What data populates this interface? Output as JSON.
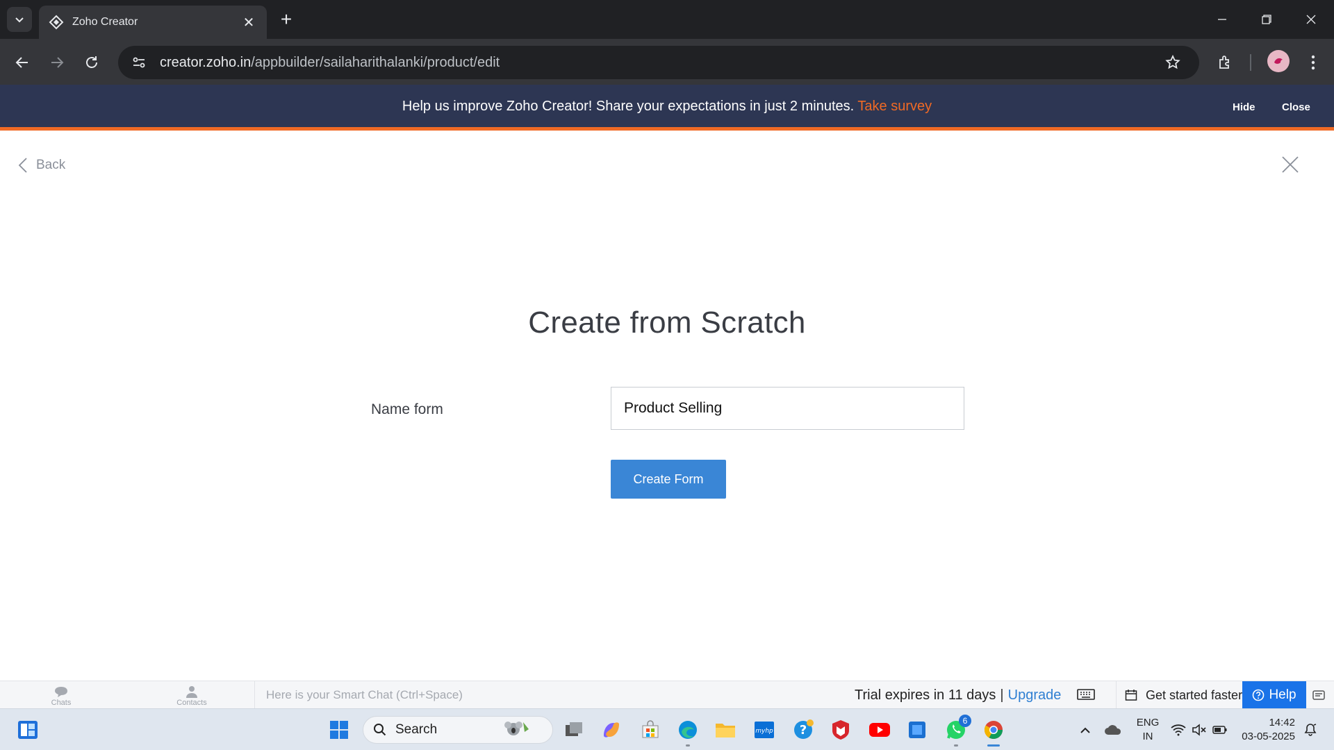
{
  "browser": {
    "tab_title": "Zoho Creator",
    "url_host": "creator.zoho.in",
    "url_path": "/appbuilder/sailaharithalanki/product/edit"
  },
  "banner": {
    "message": "Help us improve Zoho Creator! Share your expectations in just 2 minutes.",
    "link": "Take survey",
    "hide": "Hide",
    "close": "Close"
  },
  "page": {
    "back": "Back",
    "title": "Create from Scratch",
    "field_label": "Name form",
    "field_value": "Product Selling",
    "create_button": "Create Form"
  },
  "zoho_bar": {
    "chats": "Chats",
    "contacts": "Contacts",
    "smart_chat_placeholder": "Here is your Smart Chat (Ctrl+Space)",
    "trial": "Trial expires in 11 days",
    "separator": "|",
    "upgrade": "Upgrade",
    "get_started": "Get started faster!",
    "help": "Help"
  },
  "taskbar": {
    "search": "Search",
    "lang_line1": "ENG",
    "lang_line2": "IN",
    "time": "14:42",
    "date": "03-05-2025",
    "whatsapp_badge": "6"
  },
  "colors": {
    "banner_bg": "#2d3653",
    "accent_orange": "#f06a25",
    "button_blue": "#3a86d6",
    "link_blue": "#2f7fd2"
  }
}
